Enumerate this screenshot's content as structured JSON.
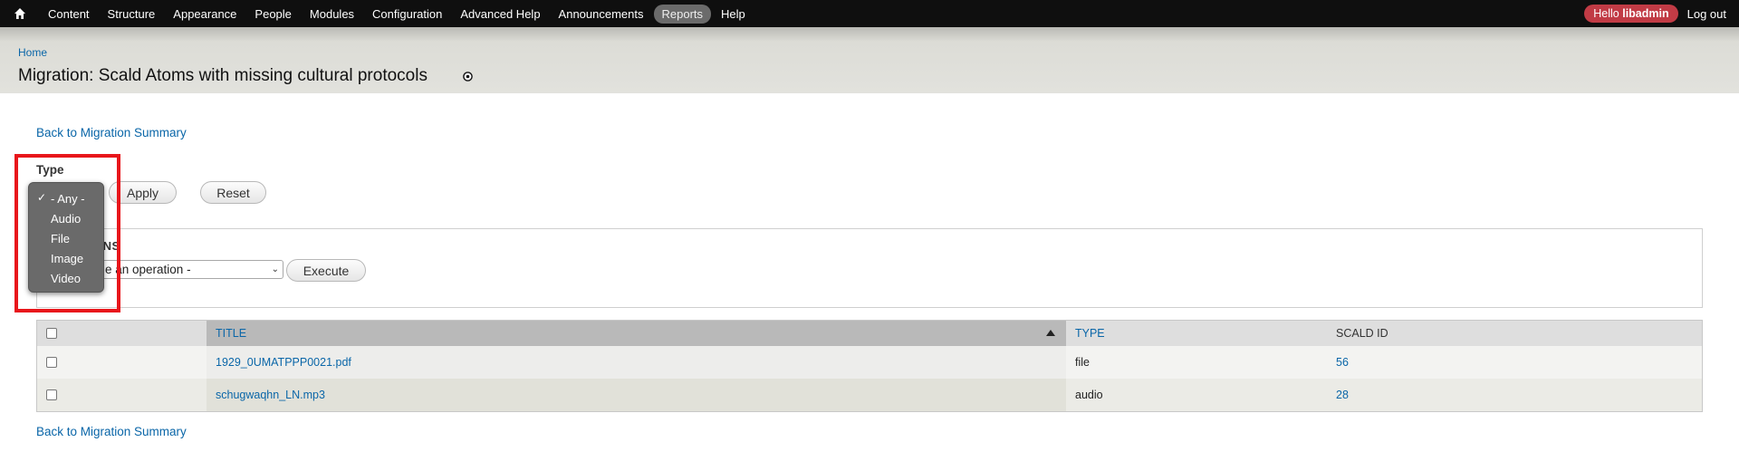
{
  "toolbar": {
    "items": [
      "Content",
      "Structure",
      "Appearance",
      "People",
      "Modules",
      "Configuration",
      "Advanced Help",
      "Announcements",
      "Reports",
      "Help"
    ],
    "active_item": "Reports",
    "hello_prefix": "Hello ",
    "hello_user": "libadmin",
    "logout": "Log out"
  },
  "header": {
    "breadcrumb": "Home",
    "title": "Migration: Scald Atoms with missing cultural protocols"
  },
  "back_link": "Back to Migration Summary",
  "filter": {
    "type_label": "Type",
    "options": [
      "- Any -",
      "Audio",
      "File",
      "Image",
      "Video"
    ],
    "selected": "- Any -",
    "apply": "Apply",
    "reset": "Reset"
  },
  "operations": {
    "legend": "ONS",
    "select_value": "e an operation -",
    "execute": "Execute"
  },
  "table": {
    "headers": {
      "title": "TITLE",
      "type": "TYPE",
      "id": "SCALD ID"
    },
    "rows": [
      {
        "title": "1929_0UMATPPP0021.pdf",
        "type": "file",
        "id": "56"
      },
      {
        "title": "schugwaqhn_LN.mp3",
        "type": "audio",
        "id": "28"
      }
    ]
  },
  "colors": {
    "link": "#0a66a8",
    "highlight": "#e8161b",
    "hello_badge": "#c13b45"
  }
}
